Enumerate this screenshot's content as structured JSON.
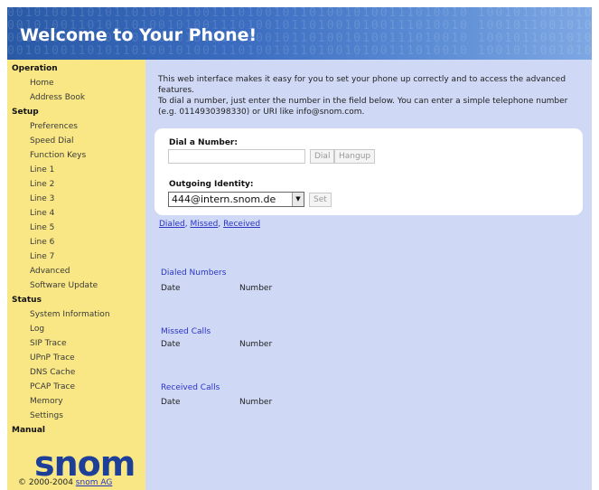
{
  "header": {
    "title": "Welcome to Your Phone!",
    "binary_pattern": "0010100110101101001010011101001011010010100111010010 1001011001010011101001010110100101001110100101 0100101001011101001010011010010110100101001"
  },
  "sidebar": {
    "sections": [
      {
        "heading": "Operation",
        "items": [
          "Home",
          "Address Book"
        ]
      },
      {
        "heading": "Setup",
        "items": [
          "Preferences",
          "Speed Dial",
          "Function Keys",
          "Line 1",
          "Line 2",
          "Line 3",
          "Line 4",
          "Line 5",
          "Line 6",
          "Line 7",
          "Advanced",
          "Software Update"
        ]
      },
      {
        "heading": "Status",
        "items": [
          "System Information",
          "Log",
          "SIP Trace",
          "UPnP Trace",
          "DNS Cache",
          "PCAP Trace",
          "Memory",
          "Settings"
        ]
      },
      {
        "heading": "Manual",
        "items": []
      }
    ],
    "logo": "snom",
    "copyright": "© 2000-2004",
    "copyright_link": "snom AG"
  },
  "main": {
    "intro_line1": "This web interface makes it easy for you to set your phone up correctly and to access the advanced",
    "intro_line2": "features.",
    "intro_line3": "To dial a number, just enter the number in the field below. You can enter a simple telephone number",
    "intro_line4": "(e.g. 0114930398330) or URI like info@snom.com.",
    "dial": {
      "label": "Dial a Number:",
      "value": "",
      "dial_button": "Dial",
      "hangup_button": "Hangup"
    },
    "identity": {
      "label": "Outgoing Identity:",
      "selected": "444@intern.snom.de",
      "set_button": "Set"
    },
    "links": {
      "dialed": "Dialed",
      "missed": "Missed",
      "received": "Received",
      "sep": ", "
    },
    "sections": [
      {
        "title": "Dialed Numbers",
        "col_date": "Date",
        "col_number": "Number"
      },
      {
        "title": "Missed Calls",
        "col_date": "Date",
        "col_number": "Number"
      },
      {
        "title": "Received Calls",
        "col_date": "Date",
        "col_number": "Number"
      }
    ]
  },
  "colors": {
    "header_blue": "#3b6cc0",
    "sidebar_yellow": "#f8e784",
    "main_background": "#cfd9f6",
    "link_blue": "#2b34c4",
    "logo_blue": "#1d3f97"
  }
}
